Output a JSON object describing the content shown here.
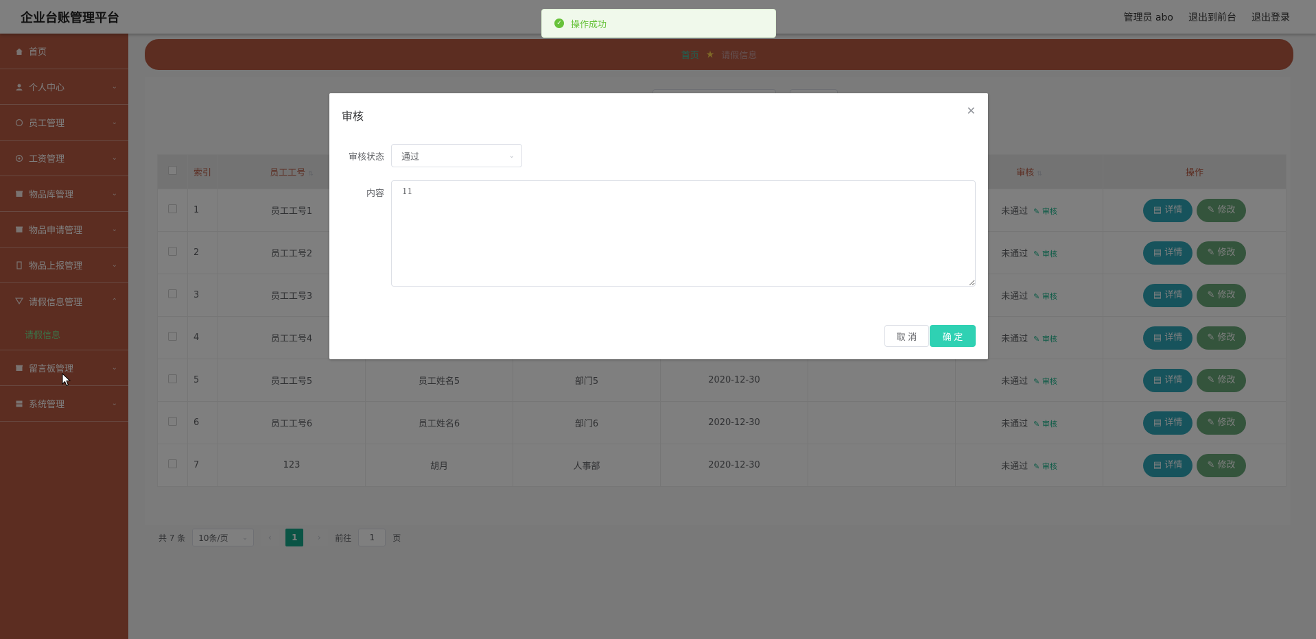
{
  "header": {
    "brand": "企业台账管理平台",
    "user": "管理员 abo",
    "to_front": "退出到前台",
    "logout": "退出登录"
  },
  "sidebar": {
    "items": [
      {
        "label": "首页",
        "icon": "home-icon"
      },
      {
        "label": "个人中心",
        "icon": "user-icon"
      },
      {
        "label": "员工管理",
        "icon": "people-icon"
      },
      {
        "label": "工资管理",
        "icon": "money-icon"
      },
      {
        "label": "物品库管理",
        "icon": "box-icon"
      },
      {
        "label": "物品申请管理",
        "icon": "apply-icon"
      },
      {
        "label": "物品上报管理",
        "icon": "report-icon"
      },
      {
        "label": "请假信息管理",
        "icon": "leave-icon"
      },
      {
        "label": "留言板管理",
        "icon": "message-icon"
      },
      {
        "label": "系统管理",
        "icon": "system-icon"
      }
    ],
    "sub_item": "请假信息"
  },
  "breadcrumb": {
    "home": "首页",
    "current": "请假信息"
  },
  "table": {
    "headers": [
      "索引",
      "员工工号",
      "审核",
      "操作"
    ],
    "rows": [
      {
        "index": "1",
        "emp_no": "员工工号1",
        "name": "",
        "dept": "",
        "date": "",
        "audit": "未通过"
      },
      {
        "index": "2",
        "emp_no": "员工工号2",
        "name": "",
        "dept": "",
        "date": "",
        "audit": "未通过"
      },
      {
        "index": "3",
        "emp_no": "员工工号3",
        "name": "",
        "dept": "",
        "date": "",
        "audit": "未通过"
      },
      {
        "index": "4",
        "emp_no": "员工工号4",
        "name": "",
        "dept": "",
        "date": "",
        "audit": "未通过"
      },
      {
        "index": "5",
        "emp_no": "员工工号5",
        "name": "员工姓名5",
        "dept": "部门5",
        "date": "2020-12-30",
        "audit": "未通过"
      },
      {
        "index": "6",
        "emp_no": "员工工号6",
        "name": "员工姓名6",
        "dept": "部门6",
        "date": "2020-12-30",
        "audit": "未通过"
      },
      {
        "index": "7",
        "emp_no": "123",
        "name": "胡月",
        "dept": "人事部",
        "date": "2020-12-30",
        "audit": "未通过"
      }
    ],
    "audit_link": "审核",
    "detail_btn": "详情",
    "edit_btn": "修改"
  },
  "pager": {
    "total": "共 7 条",
    "size": "10条/页",
    "current": "1",
    "goto_prefix": "前往",
    "goto_value": "1",
    "goto_suffix": "页"
  },
  "toast": {
    "message": "操作成功"
  },
  "dialog": {
    "title": "审核",
    "status_label": "审核状态",
    "status_value": "通过",
    "content_label": "内容",
    "content_value": "11",
    "cancel": "取 消",
    "confirm": "确 定"
  }
}
